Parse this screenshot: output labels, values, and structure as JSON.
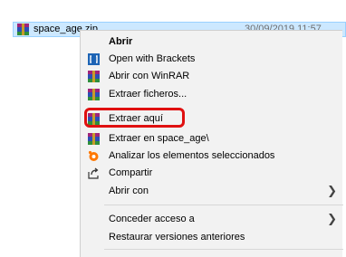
{
  "file": {
    "name": "space_age.zip",
    "date": "30/09/2019 11:57",
    "icon": "winrar-archive-icon"
  },
  "menu": {
    "items": [
      {
        "label": "Abrir",
        "bold": true,
        "icon": ""
      },
      {
        "label": "Open with Brackets",
        "icon": "brackets-icon"
      },
      {
        "label": "Abrir con WinRAR",
        "icon": "winrar-icon"
      },
      {
        "label": "Extraer ficheros...",
        "icon": "winrar-icon"
      },
      {
        "label": "Extraer aquí",
        "icon": "winrar-icon",
        "highlighted": true
      },
      {
        "label": "Extraer en space_age\\",
        "icon": "winrar-icon"
      },
      {
        "label": "Analizar los elementos seleccionados",
        "icon": "avast-icon"
      },
      {
        "label": "Compartir",
        "icon": "share-icon"
      },
      {
        "label": "Abrir con",
        "submenu": true
      },
      {
        "label": "Conceder acceso a",
        "submenu": true
      },
      {
        "label": "Restaurar versiones anteriores"
      }
    ]
  },
  "colors": {
    "highlight": "#e01010",
    "selection": "#cce8ff",
    "menu_bg": "#f2f2f2"
  }
}
